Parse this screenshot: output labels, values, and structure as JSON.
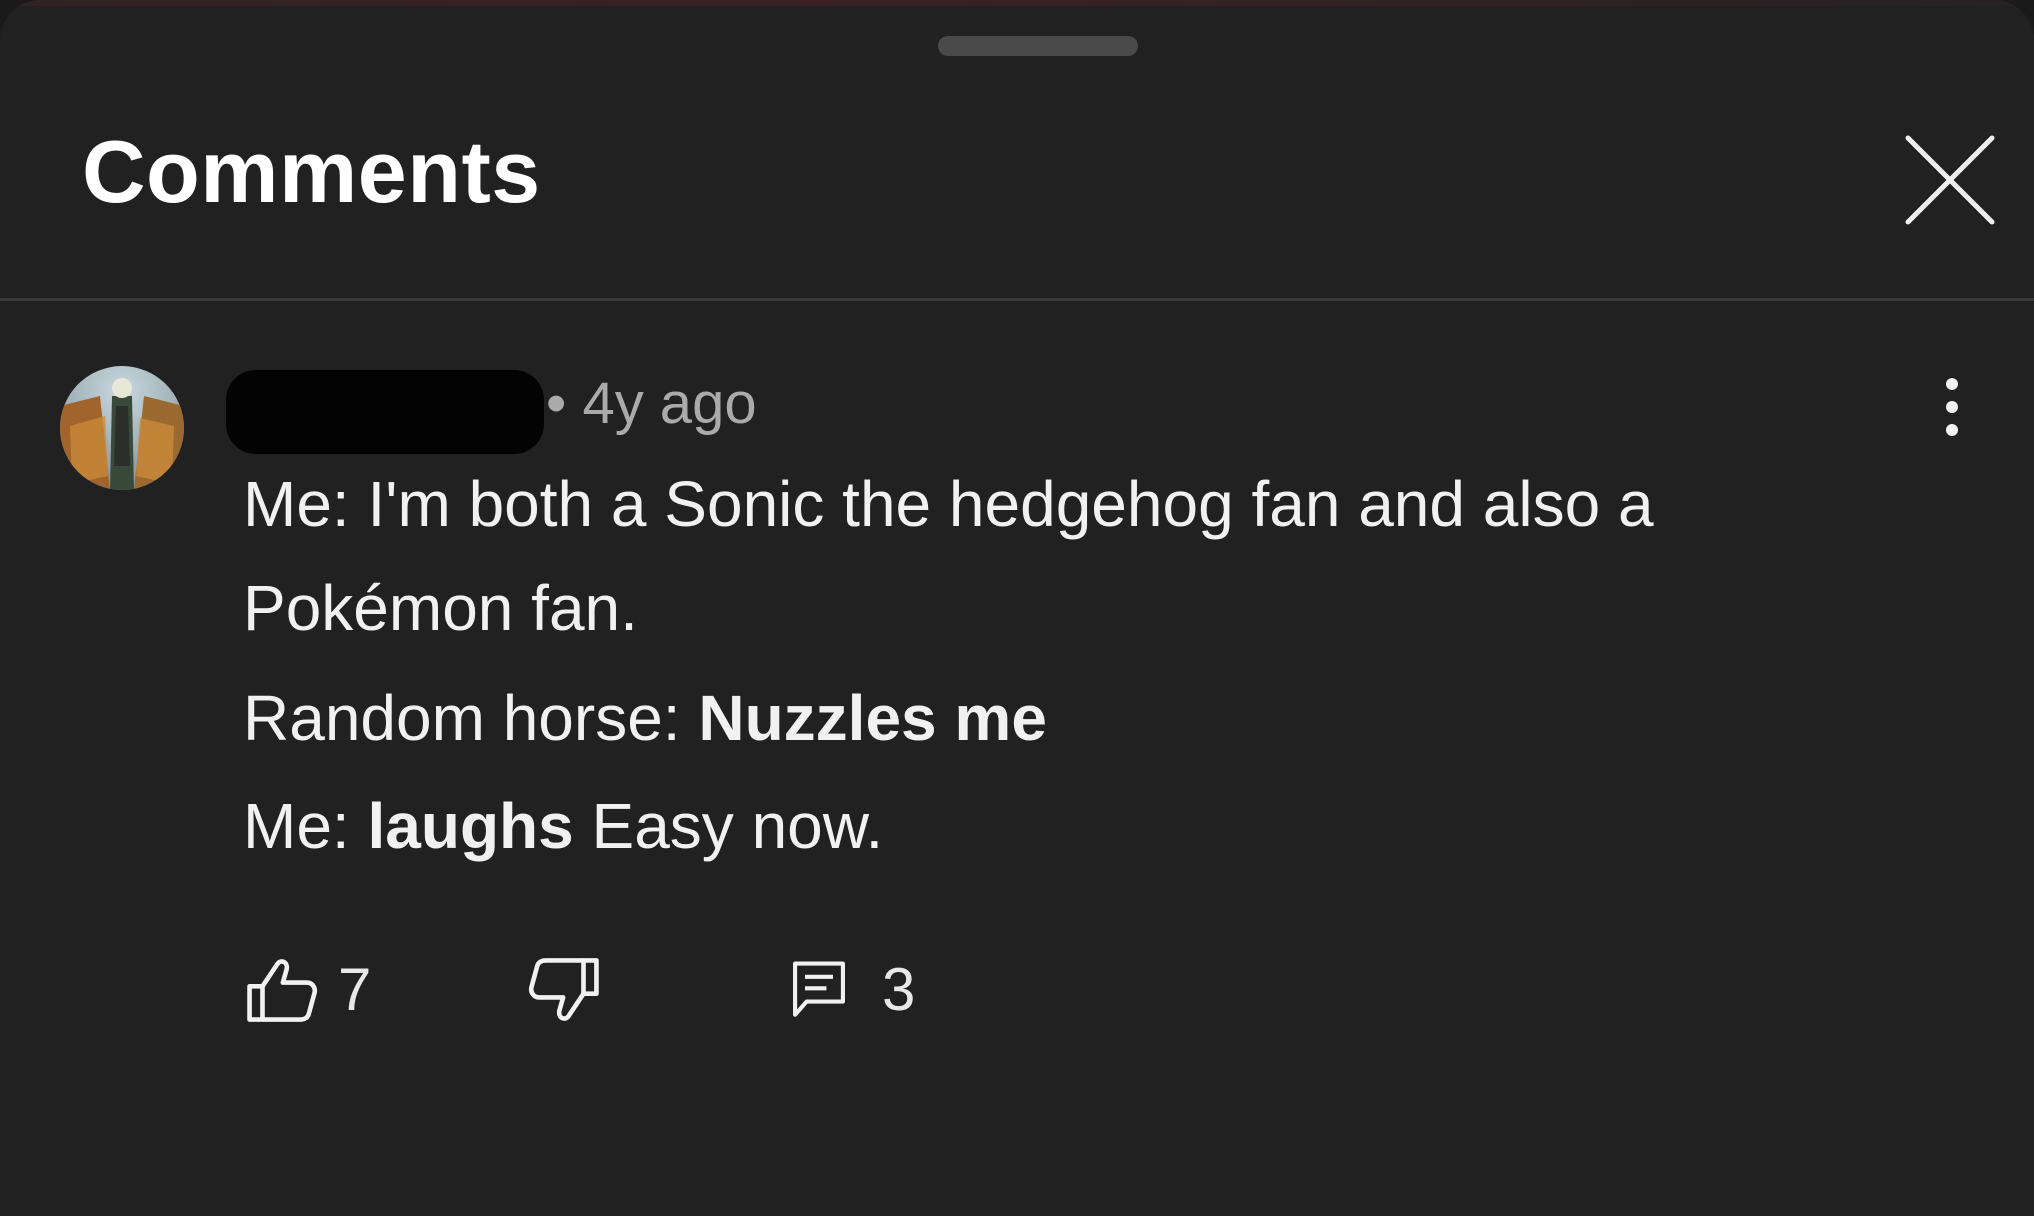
{
  "panel": {
    "title": "Comments",
    "close_icon": "close-icon"
  },
  "comment": {
    "author_redacted": true,
    "separator": "•",
    "time": "4y ago",
    "lines": [
      {
        "segments": [
          {
            "text": "Me: I'm both a Sonic the hedgehog fan and also a",
            "bold": false
          }
        ]
      },
      {
        "segments": [
          {
            "text": "Pokémon fan.",
            "bold": false
          }
        ]
      },
      {
        "segments": [
          {
            "text": "Random horse: ",
            "bold": false
          },
          {
            "text": "Nuzzles me",
            "bold": true
          }
        ]
      },
      {
        "segments": [
          {
            "text": "Me: ",
            "bold": false
          },
          {
            "text": "laughs",
            "bold": true
          },
          {
            "text": " Easy now.",
            "bold": false
          }
        ]
      }
    ],
    "likes": "7",
    "replies": "3"
  },
  "icons": {
    "like": "thumbs-up-icon",
    "dislike": "thumbs-down-icon",
    "reply": "comment-icon",
    "more": "more-vert-icon"
  },
  "colors": {
    "background": "#212121",
    "text": "#f1f1f1",
    "secondary_text": "#aaaaaa",
    "divider": "#3a3a3a"
  }
}
